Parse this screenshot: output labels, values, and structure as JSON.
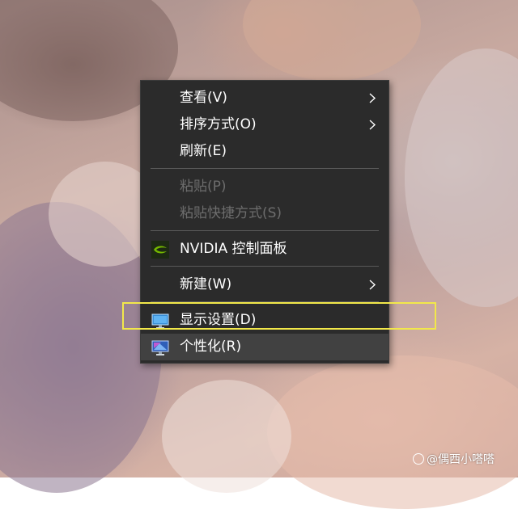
{
  "context_menu": {
    "items": [
      {
        "label": "查看(V)",
        "submenu": true
      },
      {
        "label": "排序方式(O)",
        "submenu": true
      },
      {
        "label": "刷新(E)"
      },
      {
        "label": "粘贴(P)",
        "disabled": true
      },
      {
        "label": "粘贴快捷方式(S)",
        "disabled": true
      },
      {
        "label": "NVIDIA 控制面板",
        "icon": "nvidia-icon"
      },
      {
        "label": "新建(W)",
        "submenu": true
      },
      {
        "label": "显示设置(D)",
        "icon": "monitor-icon",
        "annotated": true
      },
      {
        "label": "个性化(R)",
        "icon": "personalize-monitor-icon",
        "hovered": true
      }
    ]
  },
  "annotation": {
    "color": "#f2e84a"
  },
  "watermark": {
    "text": "@偶西小嗒嗒"
  },
  "colors": {
    "menu_background": "#2b2b2b",
    "menu_text": "#ffffff",
    "disabled_text": "#6d6d6d",
    "hover_background": "#414141",
    "nvidia_green": "#76b900"
  }
}
